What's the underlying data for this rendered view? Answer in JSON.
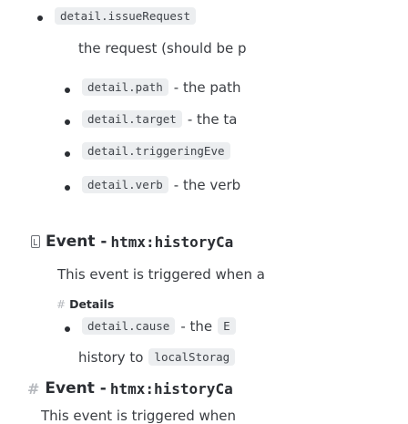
{
  "top_item": {
    "code": "detail.issueRequest"
  },
  "continuation": {
    "text": "the request (should be p"
  },
  "detail_items": [
    {
      "code": "detail.path",
      "text": "- the path"
    },
    {
      "code": "detail.target",
      "text": "- the ta"
    },
    {
      "code": "detail.triggeringEve",
      "text": ""
    },
    {
      "code": "detail.verb",
      "text": "- the verb"
    }
  ],
  "section1": {
    "prefix": "Event - ",
    "code": "htmx:historyCa",
    "description": "This event is triggered when a",
    "details_label": "Details",
    "cause_code": "detail.cause",
    "cause_text": "- the",
    "cause_tail_code": "E",
    "history_text": "history to",
    "storage_code": "localStorag"
  },
  "section2": {
    "prefix": "Event - ",
    "code": "htmx:historyCa",
    "description": "This event is triggered when"
  }
}
